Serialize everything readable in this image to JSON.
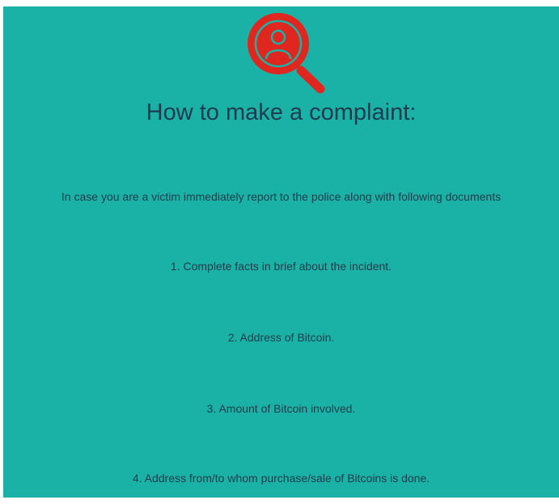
{
  "icons": {
    "header_icon": "user-search-icon",
    "icon_color": "#e0271f"
  },
  "complaint": {
    "title": "How to make a complaint:",
    "intro": "In case you are a victim immediately report to the police along with following documents",
    "documents": [
      "1. Complete facts in brief about the incident.",
      "2. Address of Bitcoin.",
      "3. Amount of Bitcoin involved.",
      "4. Address from/to whom purchase/sale of Bitcoins is done."
    ]
  },
  "colors": {
    "background": "#1ab2a6",
    "text": "#243b4b",
    "accent": "#e0271f"
  }
}
